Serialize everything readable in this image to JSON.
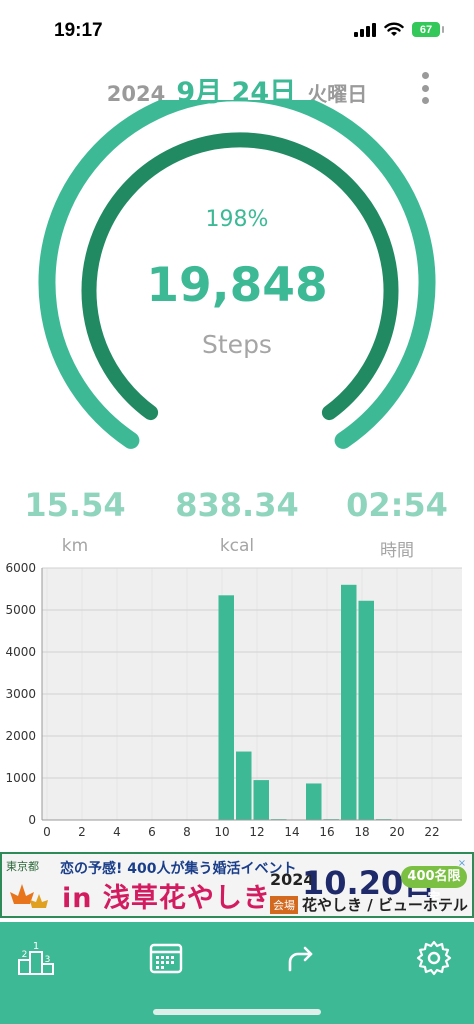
{
  "status_bar": {
    "time": "19:17",
    "battery": "67"
  },
  "header": {
    "year": "2024",
    "month_day": "9月 24日",
    "weekday": "火曜日",
    "menu_icon": "more-vertical-icon"
  },
  "summary": {
    "percent": "198%",
    "percent_value": 198,
    "steps": "19,848",
    "steps_label": "Steps"
  },
  "stats": [
    {
      "value": "15.54",
      "label": "km"
    },
    {
      "value": "838.34",
      "label": "kcal"
    },
    {
      "value": "02:54",
      "label": "時間"
    }
  ],
  "colors": {
    "accent": "#3dba95",
    "accent_dark": "#218a63",
    "bar": "#3dba95",
    "muted_value": "#8fd4bd"
  },
  "chart_data": {
    "type": "bar",
    "x": [
      0,
      1,
      2,
      3,
      4,
      5,
      6,
      7,
      8,
      9,
      10,
      11,
      12,
      13,
      14,
      15,
      16,
      17,
      18,
      19,
      20,
      21,
      22,
      23
    ],
    "values": [
      0,
      0,
      0,
      0,
      0,
      0,
      0,
      10,
      10,
      0,
      5350,
      1630,
      950,
      20,
      0,
      870,
      20,
      5600,
      5220,
      20,
      0,
      0,
      0,
      0
    ],
    "xticks": [
      "0",
      "2",
      "4",
      "6",
      "8",
      "10",
      "12",
      "14",
      "16",
      "18",
      "20",
      "22"
    ],
    "yticks": [
      "0",
      "1000",
      "2000",
      "3000",
      "4000",
      "5000",
      "6000"
    ],
    "ylim": [
      0,
      6000
    ],
    "grid": true,
    "title": "",
    "xlabel": "",
    "ylabel": ""
  },
  "ad": {
    "tag": "東京都",
    "line1": "恋の予感! 400人が集う婚活イベント",
    "line2": "in 浅草花やしき",
    "year": "2024",
    "date": "10.20日",
    "badge": "400名限定",
    "venue_tag": "会場",
    "venue": "花やしき / ビューホテル",
    "close": "×"
  },
  "tabbar": {
    "items": [
      {
        "icon": "ranking-icon"
      },
      {
        "icon": "calendar-icon"
      },
      {
        "icon": "share-icon"
      },
      {
        "icon": "settings-gear-icon"
      }
    ]
  }
}
